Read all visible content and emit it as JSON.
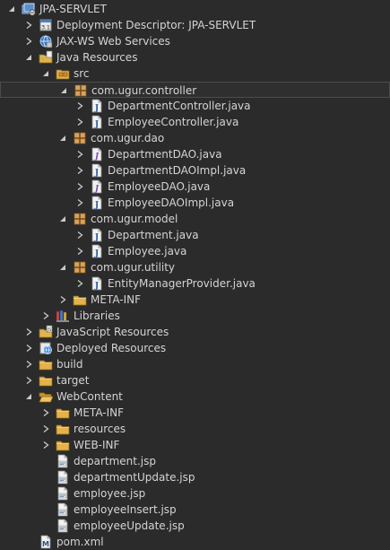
{
  "tree": [
    {
      "label": "JPA-SERVLET",
      "depth": 0,
      "expand": "open",
      "icon": "project-icon"
    },
    {
      "label": "Deployment Descriptor: JPA-SERVLET",
      "depth": 1,
      "expand": "closed",
      "icon": "deployment-descriptor-icon"
    },
    {
      "label": "JAX-WS Web Services",
      "depth": 1,
      "expand": "closed",
      "icon": "web-services-icon"
    },
    {
      "label": "Java Resources",
      "depth": 1,
      "expand": "open",
      "icon": "java-resources-icon"
    },
    {
      "label": "src",
      "depth": 2,
      "expand": "open",
      "icon": "source-folder-icon"
    },
    {
      "label": "com.ugur.controller",
      "depth": 3,
      "expand": "open",
      "icon": "package-icon",
      "selected": true
    },
    {
      "label": "DepartmentController.java",
      "depth": 4,
      "expand": "closed",
      "icon": "java-class-icon"
    },
    {
      "label": "EmployeeController.java",
      "depth": 4,
      "expand": "closed",
      "icon": "java-class-icon"
    },
    {
      "label": "com.ugur.dao",
      "depth": 3,
      "expand": "open",
      "icon": "package-icon"
    },
    {
      "label": "DepartmentDAO.java",
      "depth": 4,
      "expand": "closed",
      "icon": "java-interface-icon"
    },
    {
      "label": "DepartmentDAOImpl.java",
      "depth": 4,
      "expand": "closed",
      "icon": "java-class-icon"
    },
    {
      "label": "EmployeeDAO.java",
      "depth": 4,
      "expand": "closed",
      "icon": "java-interface-icon"
    },
    {
      "label": "EmployeeDAOImpl.java",
      "depth": 4,
      "expand": "closed",
      "icon": "java-class-icon"
    },
    {
      "label": "com.ugur.model",
      "depth": 3,
      "expand": "open",
      "icon": "package-icon"
    },
    {
      "label": "Department.java",
      "depth": 4,
      "expand": "closed",
      "icon": "java-class-icon"
    },
    {
      "label": "Employee.java",
      "depth": 4,
      "expand": "closed",
      "icon": "java-class-icon"
    },
    {
      "label": "com.ugur.utility",
      "depth": 3,
      "expand": "open",
      "icon": "package-icon"
    },
    {
      "label": "EntityManagerProvider.java",
      "depth": 4,
      "expand": "closed",
      "icon": "java-class-icon"
    },
    {
      "label": "META-INF",
      "depth": 3,
      "expand": "closed",
      "icon": "folder-icon"
    },
    {
      "label": "Libraries",
      "depth": 2,
      "expand": "closed",
      "icon": "libraries-icon"
    },
    {
      "label": "JavaScript Resources",
      "depth": 1,
      "expand": "closed",
      "icon": "javascript-resources-icon"
    },
    {
      "label": "Deployed Resources",
      "depth": 1,
      "expand": "closed",
      "icon": "deployed-resources-icon"
    },
    {
      "label": "build",
      "depth": 1,
      "expand": "closed",
      "icon": "folder-icon"
    },
    {
      "label": "target",
      "depth": 1,
      "expand": "closed",
      "icon": "folder-icon"
    },
    {
      "label": "WebContent",
      "depth": 1,
      "expand": "open",
      "icon": "folder-open-icon"
    },
    {
      "label": "META-INF",
      "depth": 2,
      "expand": "closed",
      "icon": "folder-icon"
    },
    {
      "label": "resources",
      "depth": 2,
      "expand": "closed",
      "icon": "folder-icon"
    },
    {
      "label": "WEB-INF",
      "depth": 2,
      "expand": "closed",
      "icon": "folder-icon"
    },
    {
      "label": "department.jsp",
      "depth": 2,
      "expand": "none",
      "icon": "jsp-file-icon"
    },
    {
      "label": "departmentUpdate.jsp",
      "depth": 2,
      "expand": "none",
      "icon": "jsp-file-icon"
    },
    {
      "label": "employee.jsp",
      "depth": 2,
      "expand": "none",
      "icon": "jsp-file-icon"
    },
    {
      "label": "employeeInsert.jsp",
      "depth": 2,
      "expand": "none",
      "icon": "jsp-file-icon"
    },
    {
      "label": "employeeUpdate.jsp",
      "depth": 2,
      "expand": "none",
      "icon": "jsp-file-icon"
    },
    {
      "label": "pom.xml",
      "depth": 1,
      "expand": "none",
      "icon": "maven-pom-icon"
    }
  ]
}
